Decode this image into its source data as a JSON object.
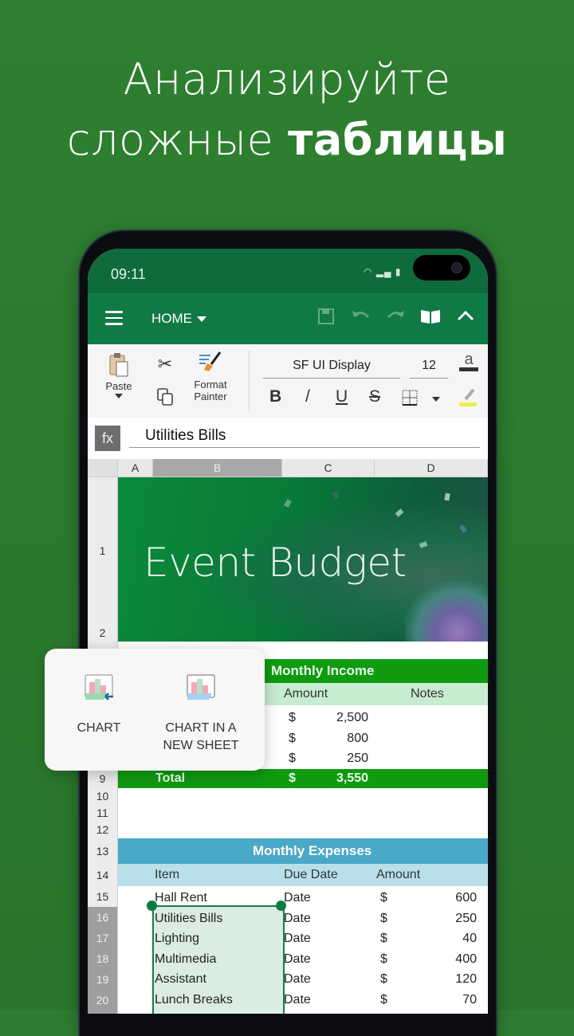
{
  "headline": {
    "line1": "Анализируйте",
    "line2_regular": "сложные",
    "line2_bold": "таблицы"
  },
  "status_bar": {
    "time": "09:11",
    "icons": "wifi-icon signal-icon battery-icon"
  },
  "app_bar": {
    "menu_icon": "hamburger-menu-icon",
    "tab_label": "HOME",
    "actions": [
      "save-icon",
      "undo-icon",
      "redo-icon",
      "read-mode-icon",
      "collapse-ribbon-icon"
    ]
  },
  "ribbon": {
    "paste_label": "Paste",
    "format_painter_label": "Format Painter",
    "format_painter_line1": "Format",
    "format_painter_line2": "Painter",
    "font_name": "SF UI Display",
    "font_size": "12",
    "bold": "B",
    "italic": "/",
    "underline": "U",
    "strikethrough": "S",
    "font_color_glyph": "a"
  },
  "formula_bar": {
    "fx_label": "fx",
    "value": "Utilities Bills"
  },
  "columns": [
    "A",
    "B",
    "C",
    "D"
  ],
  "selected_column": "B",
  "rows": [
    "1",
    "2",
    "9",
    "10",
    "11",
    "12",
    "13",
    "14",
    "15",
    "16",
    "17",
    "18",
    "19",
    "20"
  ],
  "selected_rows": [
    "16",
    "17",
    "18",
    "19",
    "20"
  ],
  "banner": {
    "title": "Event Budget"
  },
  "income": {
    "title": "Monthly Income",
    "headers": [
      "Amount",
      "Notes"
    ],
    "rows": [
      {
        "currency": "$",
        "amount": "2,500"
      },
      {
        "currency": "$",
        "amount": "800"
      },
      {
        "currency": "$",
        "amount": "250"
      }
    ],
    "total": {
      "label": "Total",
      "currency": "$",
      "amount": "3,550"
    }
  },
  "expenses": {
    "title": "Monthly Expenses",
    "headers": [
      "Item",
      "Due Date",
      "Amount"
    ],
    "rows": [
      {
        "item": "Hall Rent",
        "due": "Date",
        "currency": "$",
        "amount": "600"
      },
      {
        "item": "Utilities Bills",
        "due": "Date",
        "currency": "$",
        "amount": "250"
      },
      {
        "item": "Lighting",
        "due": "Date",
        "currency": "$",
        "amount": "40"
      },
      {
        "item": "Multimedia",
        "due": "Date",
        "currency": "$",
        "amount": "400"
      },
      {
        "item": "Assistant",
        "due": "Date",
        "currency": "$",
        "amount": "120"
      },
      {
        "item": "Lunch Breaks",
        "due": "Date",
        "currency": "$",
        "amount": "70"
      }
    ]
  },
  "popup": {
    "chart_label": "CHART",
    "chart_new_sheet_line1": "CHART IN A",
    "chart_new_sheet_line2": "NEW SHEET"
  },
  "colors": {
    "background": "#2e7d32",
    "app_bar": "#107a45",
    "income_header": "#109a10",
    "income_subheader": "#c8ecd0",
    "expenses_header": "#4aa8c8",
    "expenses_subheader": "#b9e0ea",
    "selection": "#1a7a4c"
  }
}
